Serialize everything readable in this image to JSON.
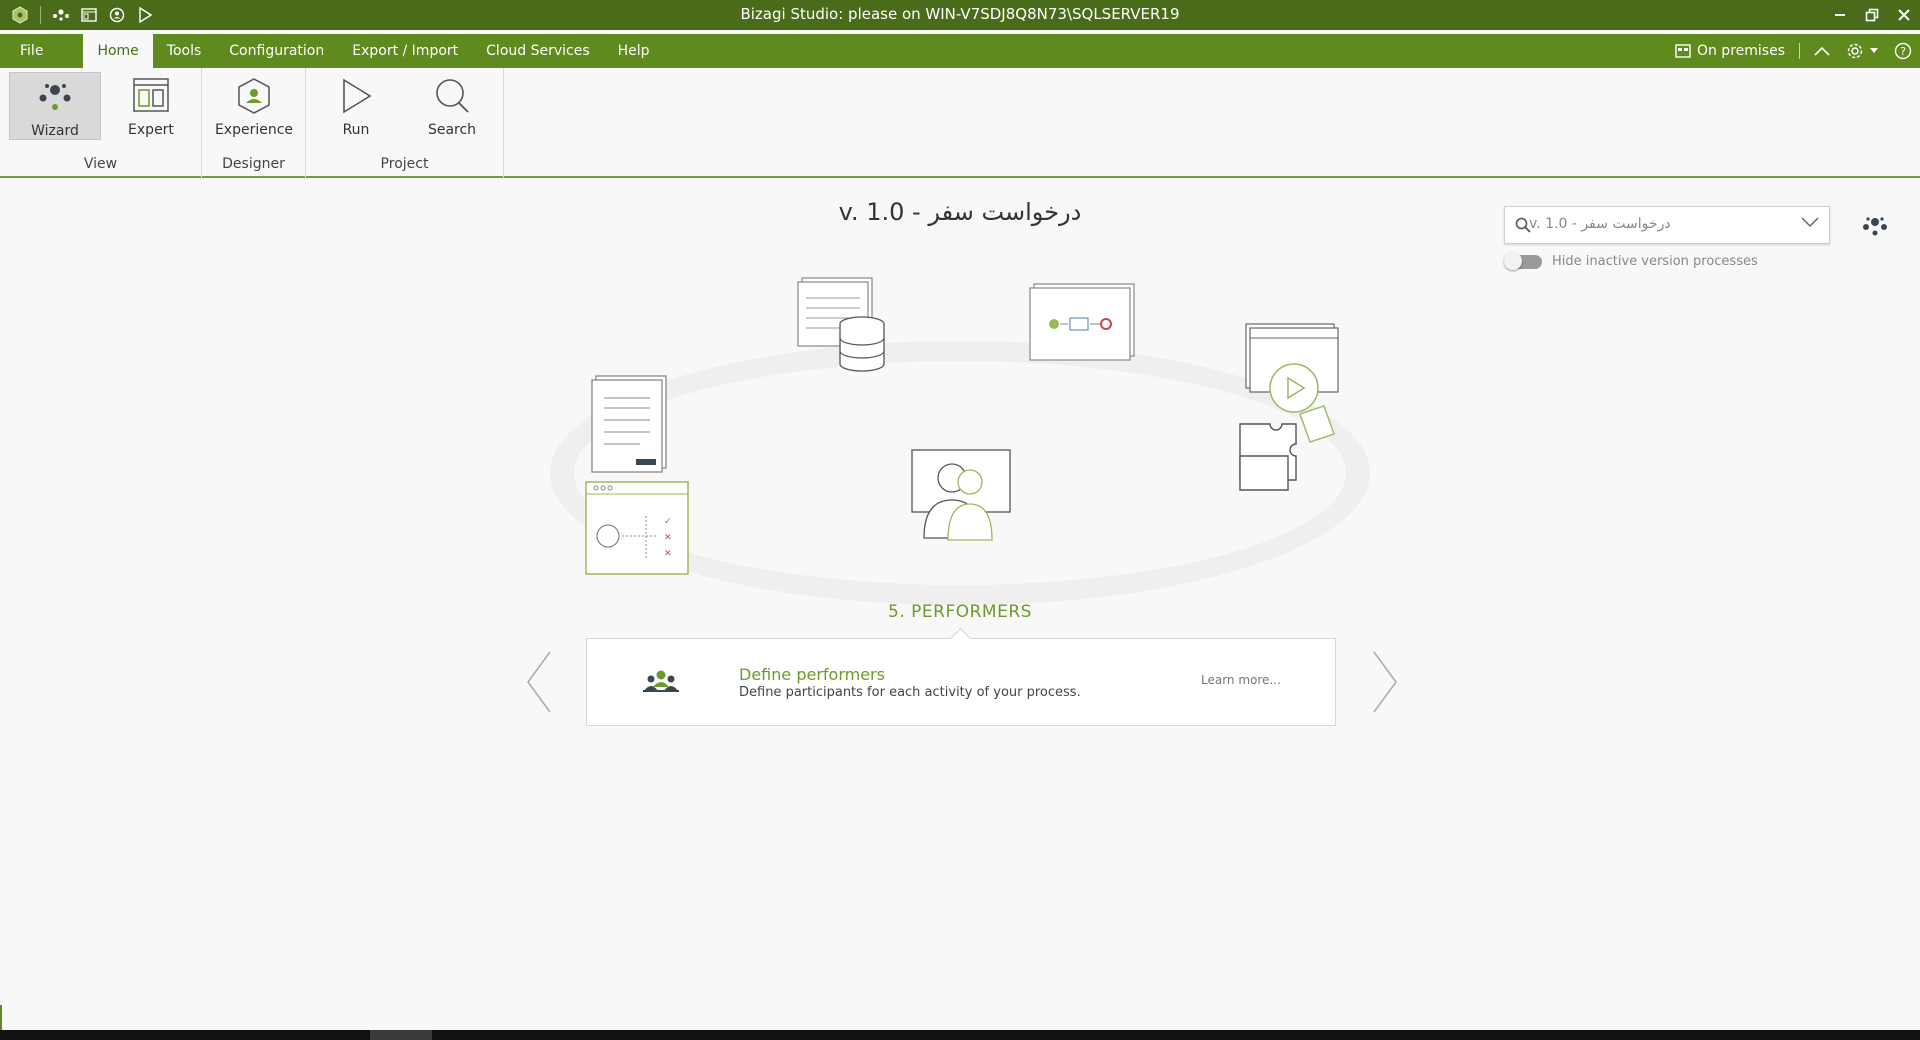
{
  "window": {
    "title": "Bizagi Studio: please  on WIN-V7SDJ8Q8N73\\SQLSERVER19"
  },
  "menu": {
    "tabs": [
      "File",
      "Home",
      "Tools",
      "Configuration",
      "Export / Import",
      "Cloud Services",
      "Help"
    ],
    "active_tab": "Home",
    "environment": "On premises"
  },
  "ribbon": {
    "groups": [
      {
        "label": "View",
        "buttons": [
          "Wizard",
          "Expert"
        ]
      },
      {
        "label": "Designer",
        "buttons": [
          "Experience"
        ]
      },
      {
        "label": "Project",
        "buttons": [
          "Run",
          "Search"
        ]
      }
    ],
    "selected_button": "Wizard"
  },
  "process": {
    "title": "درخواست سفر - v. 1.0",
    "search_value": "درخواست سفر - v. 1.0",
    "hide_inactive_label": "Hide inactive version processes",
    "hide_inactive_enabled": false
  },
  "step": {
    "label": "5. PERFORMERS",
    "card_title": "Define performers",
    "card_description": "Define participants for each activity of your process.",
    "learn_more": "Learn more..."
  },
  "colors": {
    "titlebar": "#4a6b1a",
    "menubar": "#5f8a1d",
    "accent": "#6e9a2b",
    "background": "#f8f8f8"
  }
}
